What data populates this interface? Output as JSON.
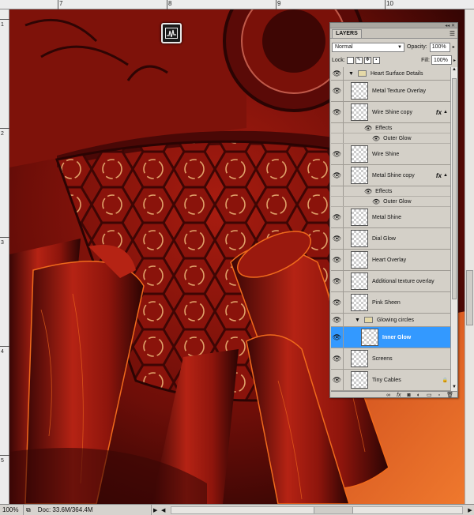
{
  "rulers": {
    "top": [
      "7",
      "8",
      "9",
      "10"
    ],
    "left": [
      "1",
      "2",
      "3",
      "4",
      "5"
    ]
  },
  "status": {
    "zoom": "100%",
    "doc": "Doc: 33.6M/364.4M"
  },
  "panel": {
    "tab": "LAYERS",
    "blend_mode": "Normal",
    "opacity_label": "Opacity:",
    "opacity": "100%",
    "lock_label": "Lock:",
    "fill_label": "Fill:",
    "fill": "100%"
  },
  "layers": [
    {
      "kind": "group",
      "name": "Heart Surface Details"
    },
    {
      "kind": "layer",
      "name": "Metal Texture Overlay"
    },
    {
      "kind": "layer",
      "name": "Wire Shine copy",
      "fx": "fx"
    },
    {
      "kind": "effects",
      "name": "Effects"
    },
    {
      "kind": "effect",
      "name": "Outer Glow"
    },
    {
      "kind": "layer",
      "name": "Wire Shine"
    },
    {
      "kind": "layer",
      "name": "Metal Shine copy",
      "fx": "fx"
    },
    {
      "kind": "effects",
      "name": "Effects"
    },
    {
      "kind": "effect",
      "name": "Outer Glow"
    },
    {
      "kind": "layer",
      "name": "Metal Shine"
    },
    {
      "kind": "layer",
      "name": "Dial Glow"
    },
    {
      "kind": "layer",
      "name": "Heart Overlay"
    },
    {
      "kind": "layer",
      "name": "Additional texture overlay"
    },
    {
      "kind": "layer",
      "name": "Pink Sheen"
    },
    {
      "kind": "group",
      "name": "Glowing circles"
    },
    {
      "kind": "layer",
      "name": "Inner Glow",
      "selected": true
    },
    {
      "kind": "layer",
      "name": "Screens"
    },
    {
      "kind": "layer",
      "name": "Tiny Cables"
    }
  ],
  "colors": {
    "selection": "#3399ff",
    "panel_bg": "#d4d0c8",
    "art_red": "#8e150c",
    "art_dark": "#3a0605",
    "art_orange": "#e0561a"
  }
}
